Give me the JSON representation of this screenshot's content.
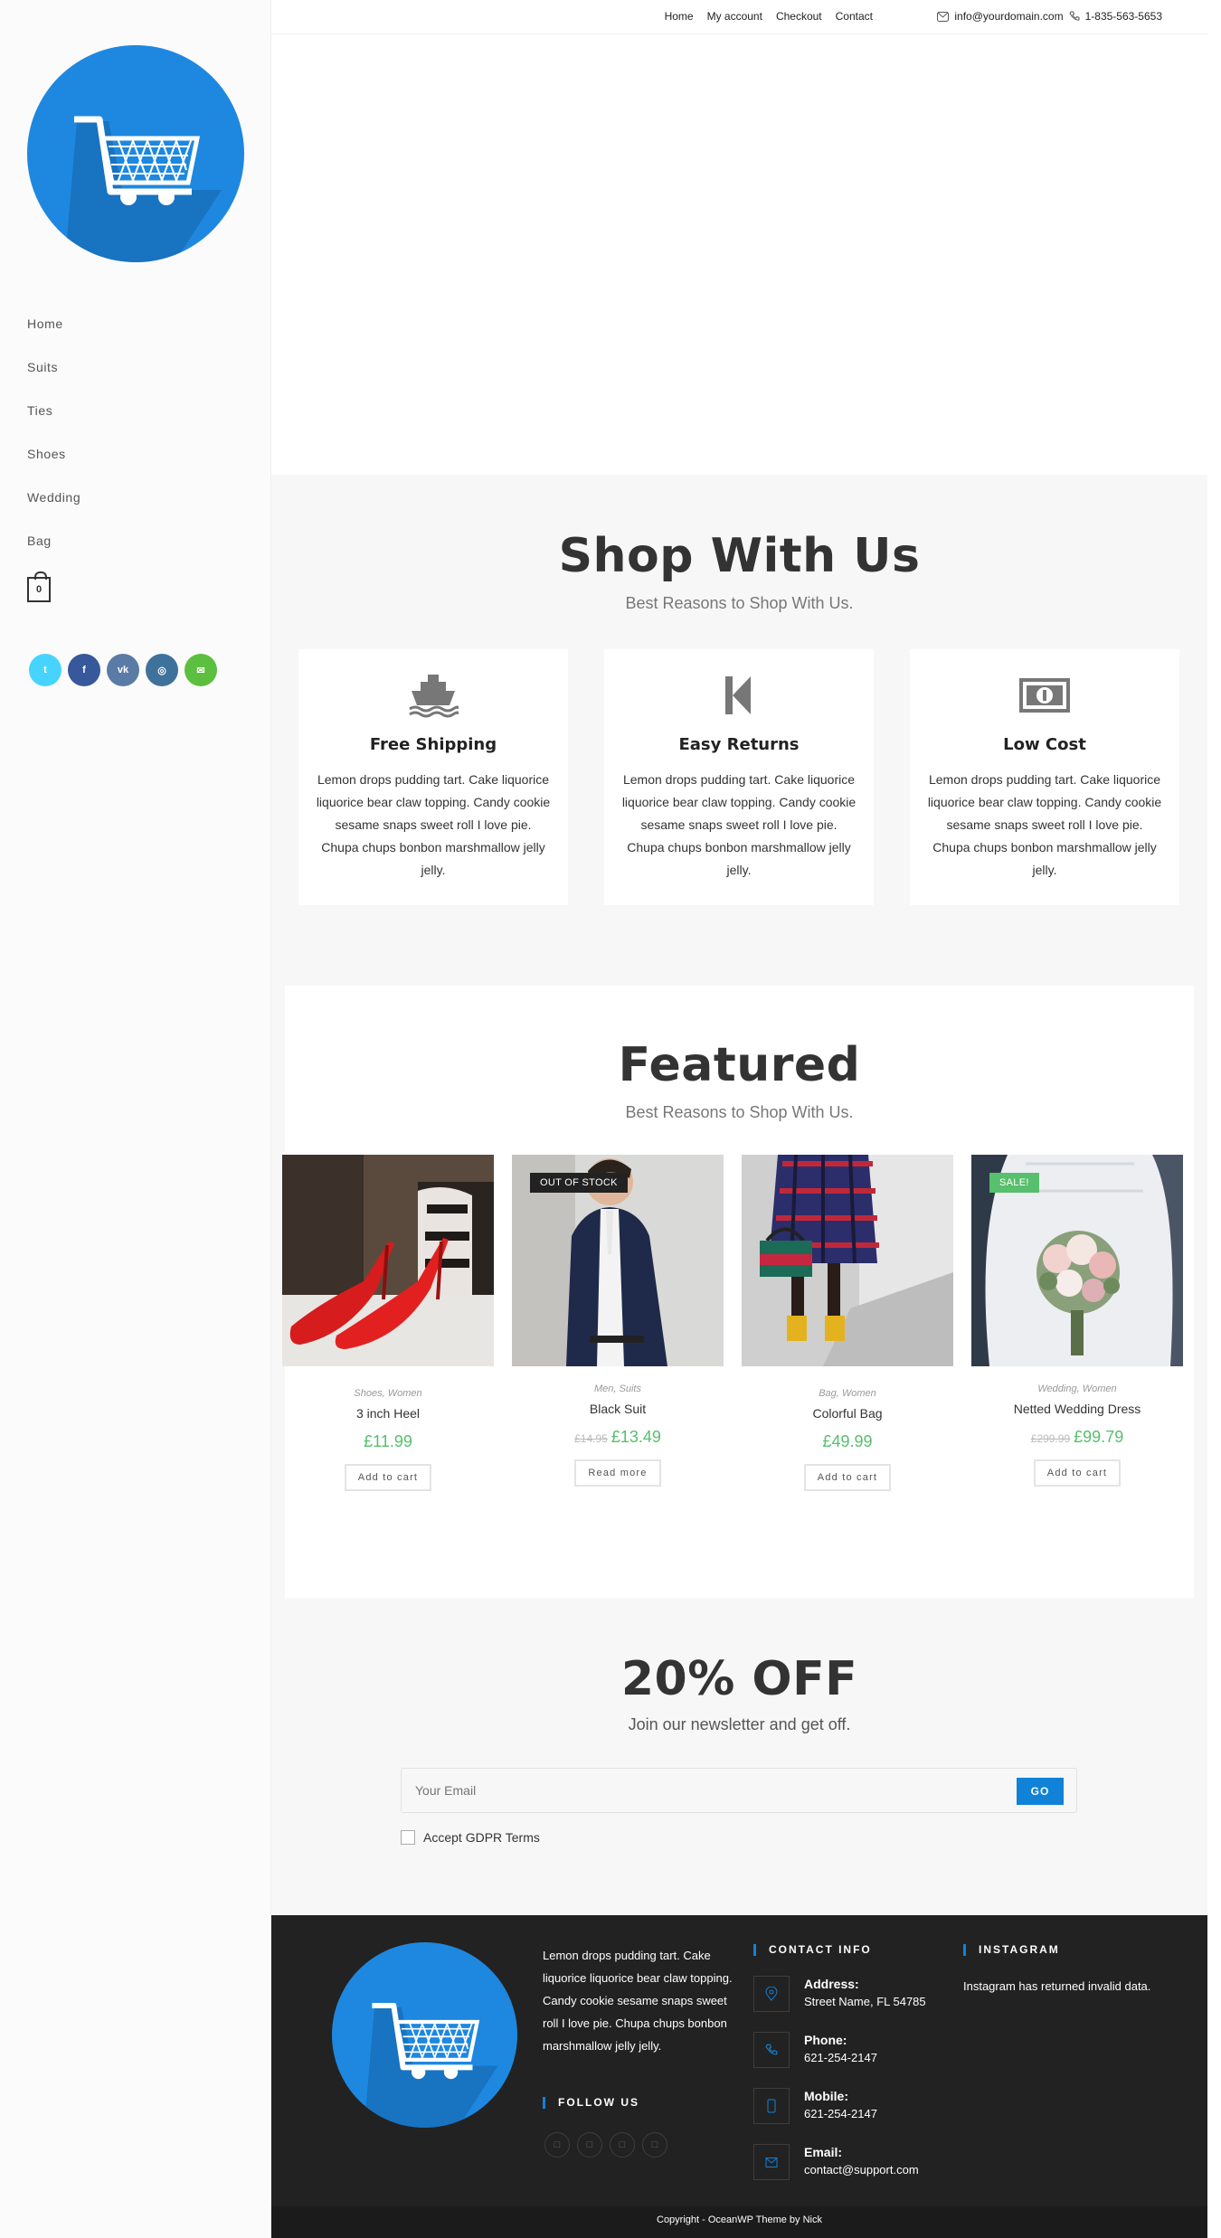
{
  "topbar": {
    "nav": [
      "Home",
      "My account",
      "Checkout",
      "Contact"
    ],
    "email": "info@yourdomain.com",
    "phone": "1-835-563-5653"
  },
  "sidebar": {
    "menu": [
      "Home",
      "Suits",
      "Ties",
      "Shoes",
      "Wedding",
      "Bag"
    ],
    "cart_count": "0",
    "social": [
      {
        "icon": "twitter-icon",
        "glyph": "t",
        "color": "#46d4fe"
      },
      {
        "icon": "facebook-icon",
        "glyph": "f",
        "color": "#37589b"
      },
      {
        "icon": "vk-icon",
        "glyph": "vk",
        "color": "#597ba5"
      },
      {
        "icon": "instagram-icon",
        "glyph": "◎",
        "color": "#3f729b"
      },
      {
        "icon": "wechat-icon",
        "glyph": "✉",
        "color": "#5cbf3f"
      }
    ]
  },
  "shop_section": {
    "title": "Shop With Us",
    "subtitle": "Best Reasons to Shop With Us.",
    "features": [
      {
        "icon": "ship-icon",
        "title": "Free Shipping",
        "text": "Lemon drops pudding tart. Cake liquorice liquorice bear claw topping. Candy cookie sesame snaps sweet roll I love pie. Chupa chups bonbon marshmallow jelly jelly."
      },
      {
        "icon": "step-backward-icon",
        "title": "Easy Returns",
        "text": "Lemon drops pudding tart. Cake liquorice liquorice bear claw topping. Candy cookie sesame snaps sweet roll I love pie. Chupa chups bonbon marshmallow jelly jelly."
      },
      {
        "icon": "money-icon",
        "title": "Low Cost",
        "text": "Lemon drops pudding tart. Cake liquorice liquorice bear claw topping. Candy cookie sesame snaps sweet roll I love pie. Chupa chups bonbon marshmallow jelly jelly."
      }
    ]
  },
  "featured_section": {
    "title": "Featured",
    "subtitle": "Best Reasons to Shop With Us.",
    "products": [
      {
        "categories": "Shoes, Women",
        "name": "3 inch Heel",
        "old_price": "",
        "price": "£11.99",
        "button": "Add to cart",
        "badge": ""
      },
      {
        "categories": "Men, Suits",
        "name": "Black Suit",
        "old_price": "£14.95",
        "price": "£13.49",
        "button": "Read more",
        "badge": "OUT OF STOCK"
      },
      {
        "categories": "Bag, Women",
        "name": "Colorful Bag",
        "old_price": "",
        "price": "£49.99",
        "button": "Add to cart",
        "badge": ""
      },
      {
        "categories": "Wedding, Women",
        "name": "Netted Wedding Dress",
        "old_price": "£299.99",
        "price": "£99.79",
        "button": "Add to cart",
        "badge": "SALE!"
      }
    ]
  },
  "newsletter": {
    "title": "20% OFF",
    "subtitle": "Join our newsletter and get off.",
    "placeholder": "Your Email",
    "button": "GO",
    "gdpr_label": "Accept GDPR Terms"
  },
  "footer": {
    "about": "Lemon drops pudding tart. Cake liquorice liquorice bear claw topping. Candy cookie sesame snaps sweet roll I love pie. Chupa chups bonbon marshmallow jelly jelly.",
    "follow_heading": "FOLLOW US",
    "contact_heading": "CONTACT INFO",
    "contacts": [
      {
        "icon": "map-pin-icon",
        "label": "Address:",
        "value": "Street Name, FL 54785"
      },
      {
        "icon": "phone-icon",
        "label": "Phone:",
        "value": "621-254-2147"
      },
      {
        "icon": "mobile-icon",
        "label": "Mobile:",
        "value": "621-254-2147"
      },
      {
        "icon": "envelope-icon",
        "label": "Email:",
        "value": "contact@support.com"
      }
    ],
    "instagram_heading": "INSTAGRAM",
    "instagram_text": "Instagram has returned invalid data.",
    "copyright": "Copyright - OceanWP Theme by Nick"
  },
  "colors": {
    "accent": "#1082d8",
    "price": "#57bf6d",
    "footer_bg": "#222222"
  }
}
